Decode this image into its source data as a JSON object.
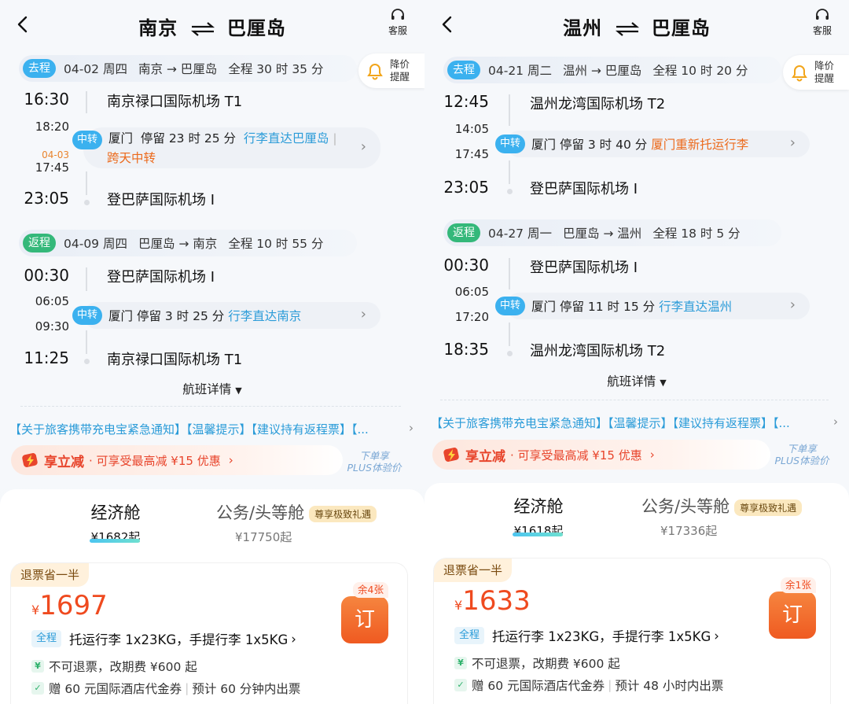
{
  "panels": [
    {
      "title_from": "南京",
      "title_to": "巴厘岛",
      "service_label": "客服",
      "price_alert": [
        "降价",
        "提醒"
      ],
      "outbound": {
        "tag": "去程",
        "date": "04-02 周四",
        "route": "南京 → 巴厘岛",
        "duration": "全程 30 时 35 分",
        "dep_time": "16:30",
        "dep_airport": "南京禄口国际机场 T1",
        "arr1_time": "18:20",
        "dep2_date": "04-03",
        "dep2_time": "17:45",
        "transfer_tag": "中转",
        "transfer_city": "厦门",
        "transfer_stay": "停留 23 时 25 分",
        "transfer_note": "行李直达巴厘岛",
        "transfer_note2": "跨天中转",
        "arr_time": "23:05",
        "arr_airport": "登巴萨国际机场 I"
      },
      "return": {
        "tag": "返程",
        "date": "04-09 周四",
        "route": "巴厘岛 → 南京",
        "duration": "全程 10 时 55 分",
        "dep_time": "00:30",
        "dep_airport": "登巴萨国际机场 I",
        "arr1_time": "06:05",
        "dep2_time": "09:30",
        "transfer_tag": "中转",
        "transfer_city": "厦门",
        "transfer_stay": "停留 3 时 25 分",
        "transfer_note": "行李直达南京",
        "arr_time": "11:25",
        "arr_airport": "南京禄口国际机场 T1"
      },
      "details_label": "航班详情",
      "notice": "【关于旅客携带充电宝紧急通知】【温馨提示】【建议持有返程票】【...",
      "promo_title": "享立减",
      "promo_desc": "· 可享受最高减 ¥15 优惠",
      "plus_lines": [
        "下单享",
        "PLUS体验价"
      ],
      "cabins": [
        {
          "name": "经济舱",
          "price": "¥1682起"
        },
        {
          "name": "公务/头等舱",
          "price": "¥17750起",
          "badge": "尊享极致礼遇"
        }
      ],
      "fare": {
        "refund_tag": "退票省一半",
        "currency": "¥",
        "price": "1697",
        "remaining": "余4张",
        "book": "订",
        "luggage_tag": "全程",
        "luggage": "托运行李 1x23KG，手提行李 1x5KG",
        "rule1": "不可退票，改期费 ¥600 起",
        "rule2a": "赠 60 元国际酒店代金券",
        "rule2b": "预计 60 分钟内出票"
      }
    },
    {
      "title_from": "温州",
      "title_to": "巴厘岛",
      "service_label": "客服",
      "price_alert": [
        "降价",
        "提醒"
      ],
      "outbound": {
        "tag": "去程",
        "date": "04-21 周二",
        "route": "温州 → 巴厘岛",
        "duration": "全程 10 时 20 分",
        "dep_time": "12:45",
        "dep_airport": "温州龙湾国际机场 T2",
        "arr1_time": "14:05",
        "dep2_time": "17:45",
        "transfer_tag": "中转",
        "transfer_city": "厦门",
        "transfer_stay": "停留 3 时 40 分",
        "transfer_note": "厦门重新托运行李",
        "arr_time": "23:05",
        "arr_airport": "登巴萨国际机场 I"
      },
      "return": {
        "tag": "返程",
        "date": "04-27 周一",
        "route": "巴厘岛 → 温州",
        "duration": "全程 18 时 5 分",
        "dep_time": "00:30",
        "dep_airport": "登巴萨国际机场 I",
        "arr1_time": "06:05",
        "dep2_time": "17:20",
        "transfer_tag": "中转",
        "transfer_city": "厦门",
        "transfer_stay": "停留 11 时 15 分",
        "transfer_note": "行李直达温州",
        "arr_time": "18:35",
        "arr_airport": "温州龙湾国际机场 T2"
      },
      "details_label": "航班详情",
      "notice": "【关于旅客携带充电宝紧急通知】【温馨提示】【建议持有返程票】【...",
      "promo_title": "享立减",
      "promo_desc": "· 可享受最高减 ¥15 优惠",
      "plus_lines": [
        "下单享",
        "PLUS体验价"
      ],
      "cabins": [
        {
          "name": "经济舱",
          "price": "¥1618起"
        },
        {
          "name": "公务/头等舱",
          "price": "¥17336起",
          "badge": "尊享极致礼遇"
        }
      ],
      "fare": {
        "refund_tag": "退票省一半",
        "currency": "¥",
        "price": "1633",
        "remaining": "余1张",
        "book": "订",
        "luggage_tag": "全程",
        "luggage": "托运行李 1x23KG，手提行李 1x5KG",
        "rule1": "不可退票，改期费 ¥600 起",
        "rule2a": "赠 60 元国际酒店代金券",
        "rule2b": "预计 48 小时内出票"
      }
    }
  ]
}
